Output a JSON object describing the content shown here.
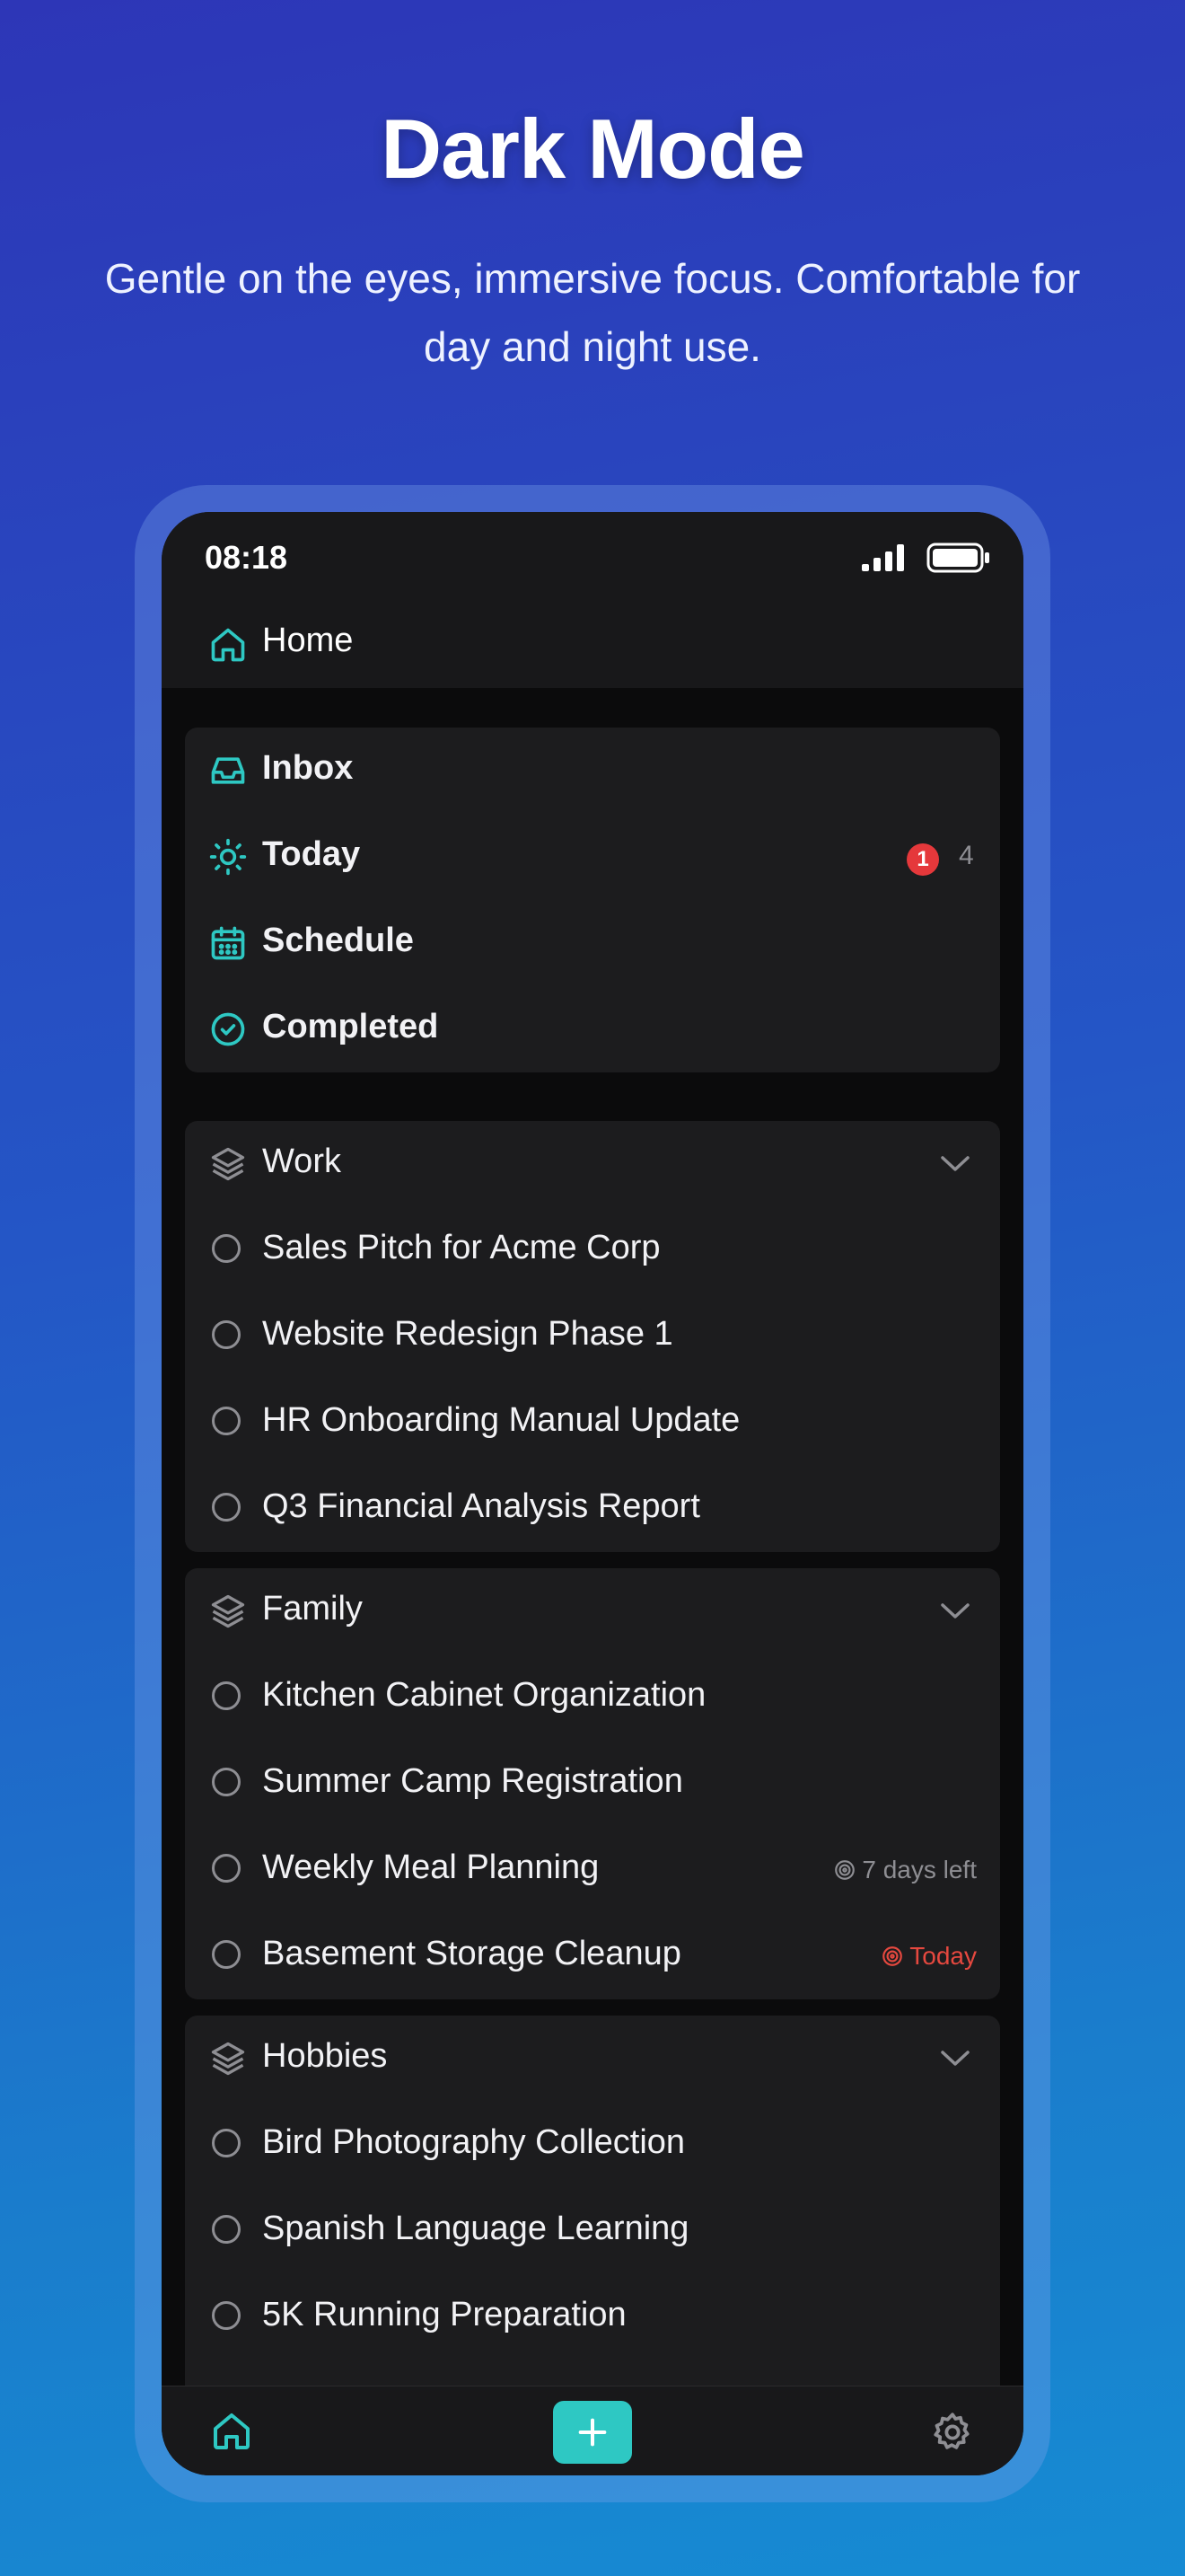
{
  "hero": {
    "title": "Dark Mode",
    "subtitle": "Gentle on the eyes, immersive focus. Comfortable for day and night use."
  },
  "status_bar": {
    "time": "08:18",
    "icons": [
      "signal-icon",
      "battery-icon"
    ]
  },
  "header": {
    "title": "Home",
    "icon": "home-icon"
  },
  "smart_lists": [
    {
      "label": "Inbox",
      "icon": "inbox-icon"
    },
    {
      "label": "Today",
      "icon": "sun-icon",
      "badge": "1",
      "count": "4"
    },
    {
      "label": "Schedule",
      "icon": "calendar-icon"
    },
    {
      "label": "Completed",
      "icon": "check-circle-icon"
    }
  ],
  "groups": [
    {
      "name": "Work",
      "icon": "layers-icon",
      "tasks": [
        {
          "title": "Sales Pitch for Acme Corp"
        },
        {
          "title": "Website Redesign Phase 1"
        },
        {
          "title": "HR Onboarding Manual Update"
        },
        {
          "title": "Q3 Financial Analysis Report"
        }
      ]
    },
    {
      "name": "Family",
      "icon": "layers-icon",
      "tasks": [
        {
          "title": "Kitchen Cabinet Organization"
        },
        {
          "title": "Summer Camp Registration"
        },
        {
          "title": "Weekly Meal Planning",
          "due": "7 days left"
        },
        {
          "title": "Basement Storage Cleanup",
          "due": "Today"
        }
      ]
    },
    {
      "name": "Hobbies",
      "icon": "layers-icon",
      "tasks": [
        {
          "title": "Bird Photography Collection"
        },
        {
          "title": "Spanish Language Learning"
        },
        {
          "title": "5K Running Preparation"
        }
      ]
    }
  ],
  "tab_bar": {
    "items": [
      "home-icon",
      "add-icon",
      "gear-icon"
    ]
  },
  "colors": {
    "accent": "#2ec8c3",
    "badge": "#e5383b",
    "due_today": "#e5483f",
    "background": "#0b0b0c",
    "card": "#1c1c1e"
  }
}
